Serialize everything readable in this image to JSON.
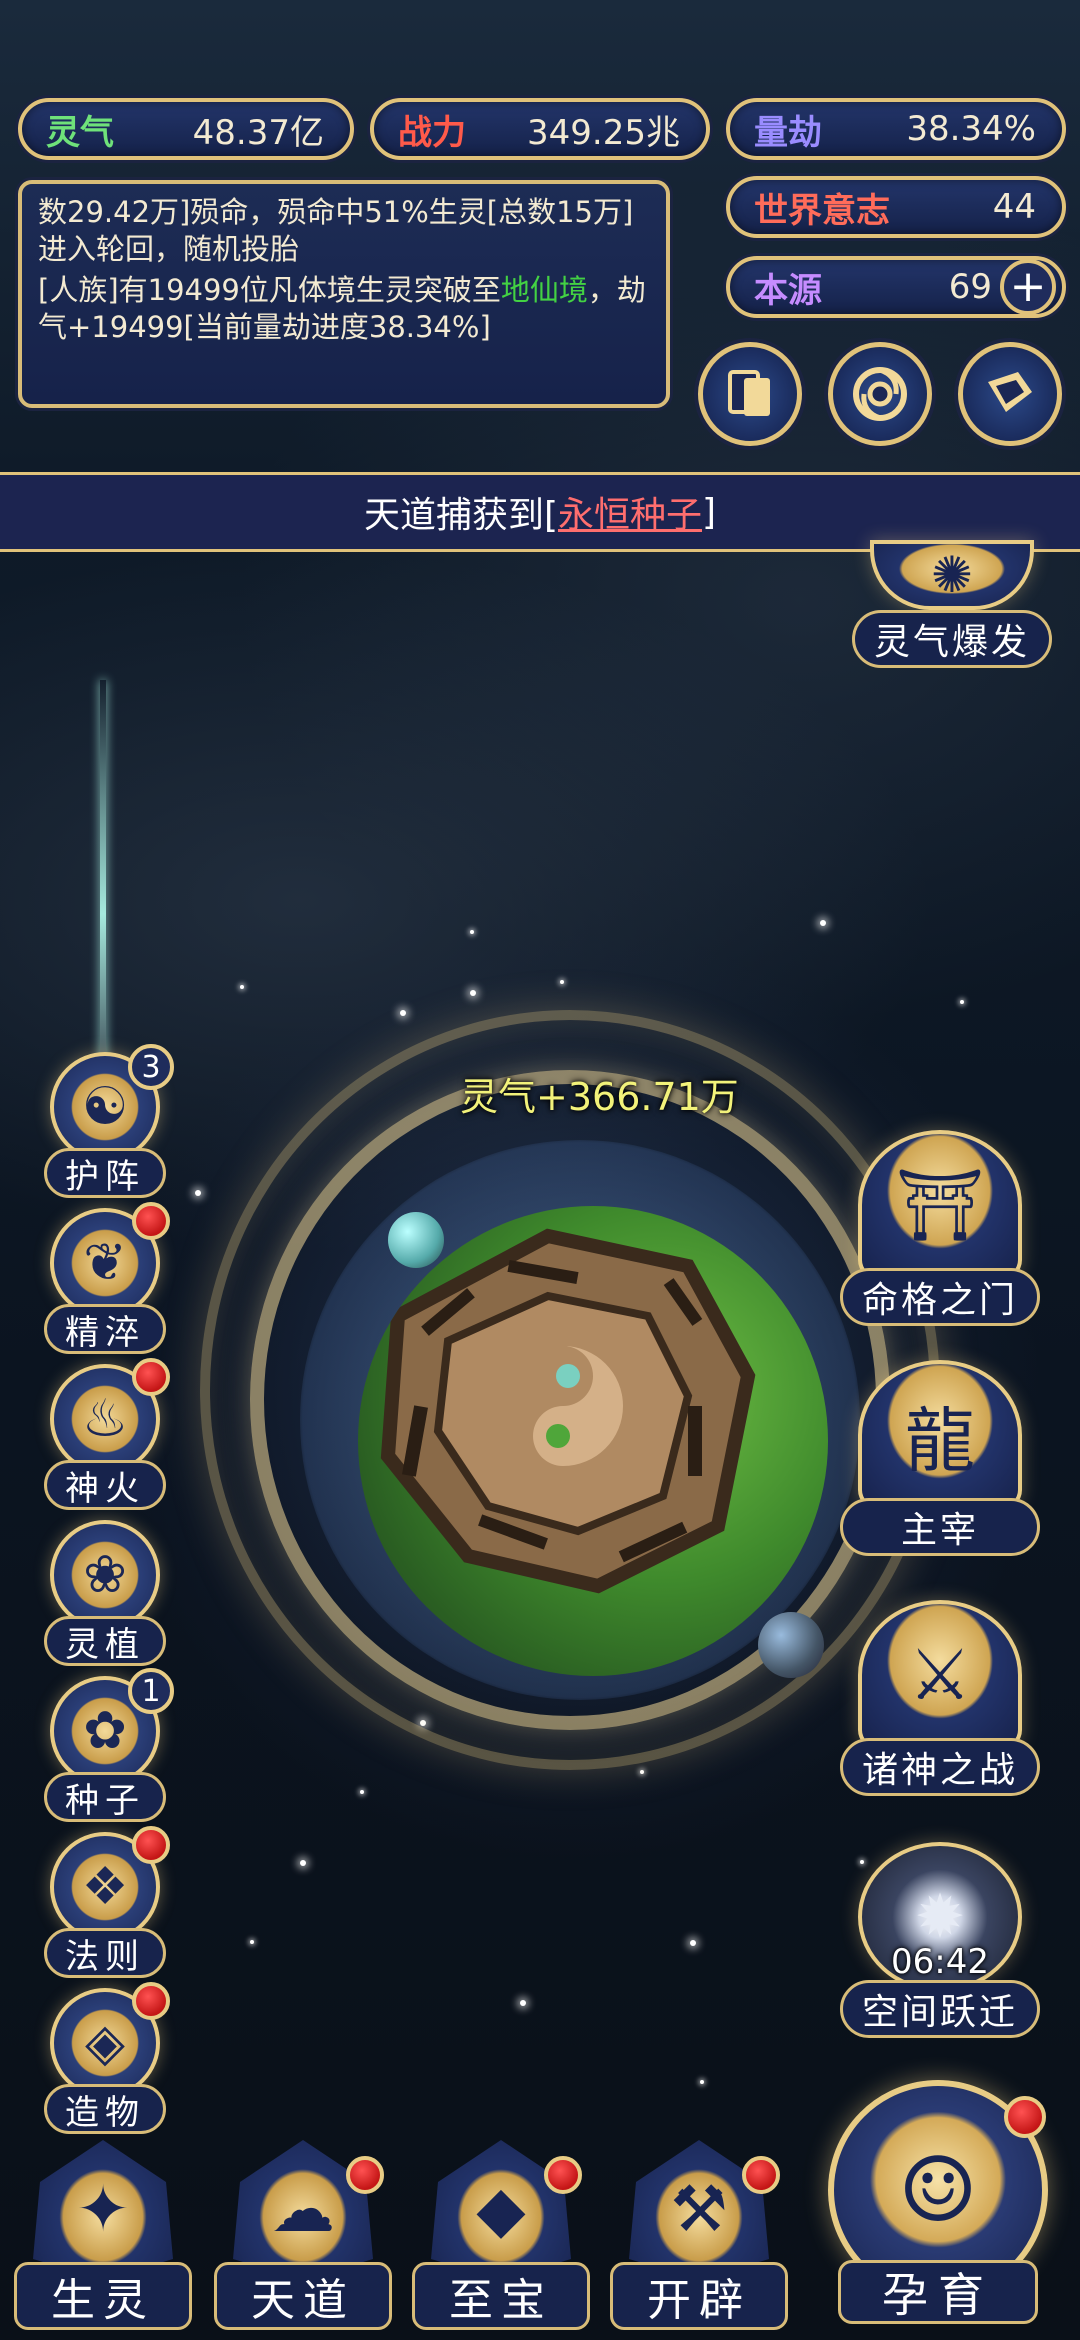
{
  "resources": {
    "lingqi": {
      "label": "灵气",
      "value": "48.37亿"
    },
    "zhanli": {
      "label": "战力",
      "value": "349.25兆"
    },
    "liangjie": {
      "label": "量劫",
      "value": "38.34%"
    },
    "shijie": {
      "label": "世界意志",
      "value": "44"
    },
    "benyuan": {
      "label": "本源",
      "value": "69",
      "add_icon": "plus-icon"
    }
  },
  "log": {
    "line1": "数29.42万]殒命，殒命中51%生灵[总数15万]进入轮回，随机投胎",
    "line2_a": "[人族]有19499位凡体境生灵突破至",
    "line2_highlight": "地仙境",
    "line2_b": "，劫气+19499[当前量劫进度38.34%]"
  },
  "top_icons": [
    "cards-icon",
    "vortex-icon",
    "scroll-icon"
  ],
  "banner": {
    "prefix": "天道捕获到[",
    "item": "永恒种子",
    "suffix": "]"
  },
  "floating_gain": "灵气+366.71万",
  "right_buttons": {
    "burst": "灵气爆发",
    "fate_gate": "命格之门",
    "master": "主宰",
    "gods_war": "诸神之战",
    "space_jump": "空间跃迁",
    "space_timer": "06:42",
    "nurture": "孕育"
  },
  "left_buttons": [
    {
      "label": "护阵",
      "glyph": "☯",
      "badge": "3"
    },
    {
      "label": "精淬",
      "glyph": "❦",
      "dot": true
    },
    {
      "label": "神火",
      "glyph": "♨",
      "dot": true
    },
    {
      "label": "灵植",
      "glyph": "❀"
    },
    {
      "label": "种子",
      "glyph": "✿",
      "badge": "1"
    },
    {
      "label": "法则",
      "glyph": "❖",
      "dot": true
    },
    {
      "label": "造物",
      "glyph": "◈",
      "dot": true
    }
  ],
  "bottom_nav": [
    {
      "label": "生灵"
    },
    {
      "label": "天道",
      "dot": true
    },
    {
      "label": "至宝",
      "dot": true
    },
    {
      "label": "开辟",
      "dot": true
    }
  ],
  "colors": {
    "gold": "#e0c27a",
    "panel": "#1c2a55",
    "alert_red": "#d42020",
    "highlight_green": "#43d243",
    "gain_yellow": "#f2f27a"
  }
}
